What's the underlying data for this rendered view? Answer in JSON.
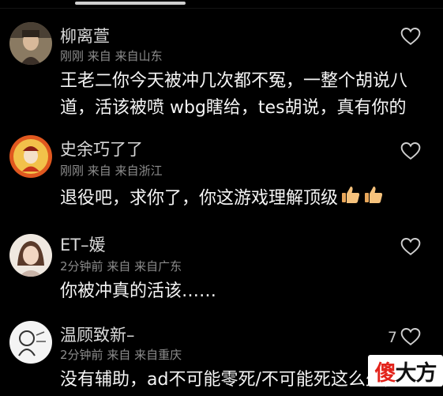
{
  "comments": [
    {
      "name": "柳离萱",
      "time": "刚刚",
      "from": "来自",
      "location": "来自山东",
      "text": "王老二你今天被冲几次都不冤，一整个胡说八道，活该被喷 wbg瞎给，tes胡说，真有你的",
      "likes": ""
    },
    {
      "name": "史余巧了了",
      "time": "刚刚",
      "from": "来自",
      "location": "来自浙江",
      "text": "退役吧，求你了，你这游戏理解顶级",
      "likes": ""
    },
    {
      "name": "ET–媛",
      "time": "2分钟前",
      "from": "来自",
      "location": "来自广东",
      "text": "你被冲真的活该……",
      "likes": ""
    },
    {
      "name": "温顾致新–",
      "time": "2分钟前",
      "from": "来自",
      "location": "来自重庆",
      "text": "没有辅助，ad不可能零死/不可能死这么少，",
      "likes": "7"
    }
  ],
  "watermark": {
    "part1": "傻",
    "part2": "大方"
  },
  "icons": {
    "like": "heart-outline-icon",
    "thumbs": "thumbs-up-icon"
  },
  "colors": {
    "background": "#000000",
    "meta": "#8c8c8c",
    "watermark_red": "#e3231b"
  }
}
